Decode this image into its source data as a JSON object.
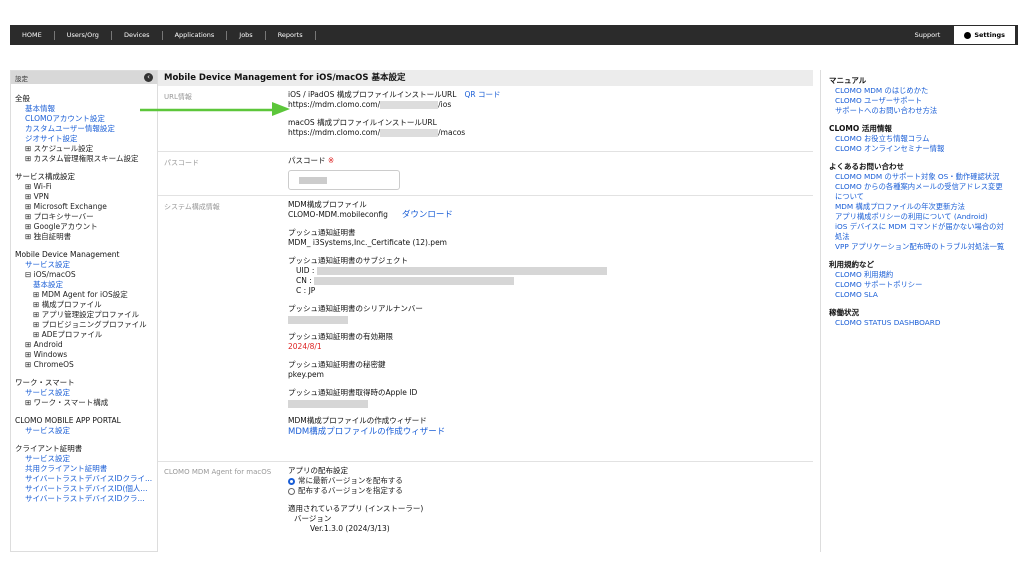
{
  "nav": {
    "items": [
      "HOME",
      "Users/Org",
      "Devices",
      "Applications",
      "Jobs",
      "Reports"
    ],
    "support": "Support",
    "settings": "Settings"
  },
  "sidebar": {
    "header": "設定",
    "sections": [
      {
        "title": "全般",
        "items": [
          {
            "label": "基本情報",
            "type": "link",
            "indent": 1
          },
          {
            "label": "CLOMOアカウント設定",
            "type": "link",
            "indent": 1
          },
          {
            "label": "カスタムユーザー情報設定",
            "type": "link",
            "indent": 1
          },
          {
            "label": "ジオサイト設定",
            "type": "link",
            "indent": 1
          },
          {
            "label": "⊞ スケジュール設定",
            "type": "text",
            "indent": 1
          },
          {
            "label": "⊞ カスタム管理権限スキーム設定",
            "type": "text",
            "indent": 1
          }
        ]
      },
      {
        "title": "サービス構成設定",
        "items": [
          {
            "label": "⊞ Wi-Fi",
            "type": "text",
            "indent": 1
          },
          {
            "label": "⊞ VPN",
            "type": "text",
            "indent": 1
          },
          {
            "label": "⊞ Microsoft Exchange",
            "type": "text",
            "indent": 1
          },
          {
            "label": "⊞ プロキシサーバー",
            "type": "text",
            "indent": 1
          },
          {
            "label": "⊞ Googleアカウント",
            "type": "text",
            "indent": 1
          },
          {
            "label": "⊞ 独自証明書",
            "type": "text",
            "indent": 1
          }
        ]
      },
      {
        "title": "Mobile Device Management",
        "items": [
          {
            "label": "サービス設定",
            "type": "link",
            "indent": 1
          },
          {
            "label": "⊟ iOS/macOS",
            "type": "text",
            "indent": 1
          },
          {
            "label": "基本設定",
            "type": "link",
            "indent": 2
          },
          {
            "label": "⊞ MDM Agent for iOS設定",
            "type": "text",
            "indent": 2
          },
          {
            "label": "⊞ 構成プロファイル",
            "type": "text",
            "indent": 2
          },
          {
            "label": "⊞ アプリ管理設定プロファイル",
            "type": "text",
            "indent": 2
          },
          {
            "label": "⊞ プロビジョニングプロファイル",
            "type": "text",
            "indent": 2
          },
          {
            "label": "⊞ ADEプロファイル",
            "type": "text",
            "indent": 2
          },
          {
            "label": "⊞ Android",
            "type": "text",
            "indent": 1
          },
          {
            "label": "⊞ Windows",
            "type": "text",
            "indent": 1
          },
          {
            "label": "⊞ ChromeOS",
            "type": "text",
            "indent": 1
          }
        ]
      },
      {
        "title": "ワーク・スマート",
        "items": [
          {
            "label": "サービス設定",
            "type": "link",
            "indent": 1
          },
          {
            "label": "⊞ ワーク・スマート構成",
            "type": "text",
            "indent": 1
          }
        ]
      },
      {
        "title": "CLOMO MOBILE APP PORTAL",
        "items": [
          {
            "label": "サービス設定",
            "type": "link",
            "indent": 1
          }
        ]
      },
      {
        "title": "クライアント証明書",
        "items": [
          {
            "label": "サービス設定",
            "type": "link",
            "indent": 1
          },
          {
            "label": "共用クライアント証明書",
            "type": "link",
            "indent": 1
          },
          {
            "label": "サイバートラストデバイスIDクライ...",
            "type": "link",
            "indent": 1
          },
          {
            "label": "サイバートラストデバイスID(個人...",
            "type": "link",
            "indent": 1
          },
          {
            "label": "サイバートラストデバイスIDクラ...",
            "type": "link",
            "indent": 1
          }
        ]
      }
    ]
  },
  "main": {
    "title": "Mobile Device Management for iOS/macOS 基本設定",
    "url": {
      "label": "URL情報",
      "ios_heading": "iOS / iPadOS 構成プロファイルインストールURL",
      "qr": "QR コード",
      "ios_prefix": "https://mdm.clomo.com/",
      "ios_suffix": "/ios",
      "mac_heading": "macOS 構成プロファイルインストールURL",
      "mac_prefix": "https://mdm.clomo.com/",
      "mac_suffix": "/macos"
    },
    "passcode": {
      "label": "パスコード",
      "heading": "パスコード",
      "required": "※"
    },
    "system": {
      "label": "システム構成情報",
      "mdm_profile_h": "MDM構成プロファイル",
      "mdm_profile_v": "CLOMO-MDM.mobileconfig",
      "download": "ダウンロード",
      "push_cert_h": "プッシュ通知証明書",
      "push_cert_v": "MDM_ i3Systems,Inc._Certificate (12).pem",
      "subject_h": "プッシュ通知証明書のサブジェクト",
      "uid": "UID",
      "cn": "CN",
      "c": "C",
      "sep": ":",
      "c_val": "JP",
      "serial_h": "プッシュ通知証明書のシリアルナンバー",
      "expiry_h": "プッシュ通知証明書の有効期限",
      "expiry_v": "2024/8/1",
      "key_h": "プッシュ通知証明書の秘密鍵",
      "key_v": "pkey.pem",
      "appleid_h": "プッシュ通知証明書取得時のApple ID",
      "wizard_h": "MDM構成プロファイルの作成ウィザード",
      "wizard_link": "MDM構成プロファイルの作成ウィザード"
    },
    "agent": {
      "label": "CLOMO MDM Agent for macOS",
      "dist_h": "アプリの配布設定",
      "opt1": "常に最新バージョンを配布する",
      "opt2": "配布するバージョンを指定する",
      "applied_h": "適用されているアプリ (インストーラー)",
      "version_h": "バージョン",
      "version_v": "Ver.1.3.0 (2024/3/13)"
    }
  },
  "right": {
    "groups": [
      {
        "title": "マニュアル",
        "links": [
          "CLOMO MDM のはじめかた",
          "CLOMO ユーザーサポート",
          "サポートへのお問い合わせ方法"
        ]
      },
      {
        "title": "CLOMO 活用情報",
        "links": [
          "CLOMO お役立ち情報コラム",
          "CLOMO オンラインセミナー情報"
        ]
      },
      {
        "title": "よくあるお問い合わせ",
        "links": [
          "CLOMO MDM のサポート対象 OS・動作確認状況",
          "CLOMO からの各種案内メールの受信アドレス変更",
          "について",
          "MDM 構成プロファイルの年次更新方法",
          "アプリ構成ポリシーの利用について (Android)",
          "iOS デバイスに MDM コマンドが届かない場合の対",
          "処法",
          "VPP アプリケーション配布時のトラブル対処法一覧"
        ]
      },
      {
        "title": "利用規約など",
        "links": [
          "CLOMO 利用規約",
          "CLOMO サポートポリシー",
          "CLOMO SLA"
        ]
      },
      {
        "title": "稼働状況",
        "links": [
          "CLOMO STATUS DASHBOARD"
        ]
      }
    ]
  },
  "colors": {
    "accent": "#1a5ed6",
    "arrow": "#5cc63a",
    "required": "#dd2222"
  }
}
